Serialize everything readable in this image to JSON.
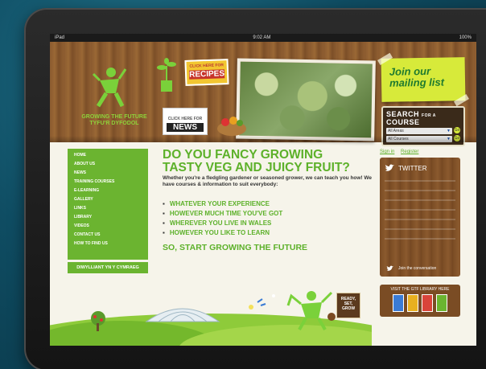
{
  "status_bar": {
    "device": "iPad",
    "time": "9:02 AM",
    "battery": "100%"
  },
  "header": {
    "tagline_line1": "GROWING THE FUTURE",
    "tagline_line2": "TYFU'R DYFODOL",
    "recipes_small": "CLICK HERE FOR",
    "recipes_big": "RECIPES",
    "news_small": "CLICK HERE FOR",
    "news_big": "NEWS",
    "mailing_line1": "Join our",
    "mailing_line2": "mailing list",
    "search_title": "SEARCH",
    "search_for": "FOR A",
    "search_course": "COURSE",
    "area_value": "All Areas",
    "course_value": "All Courses",
    "go_label": "Go"
  },
  "nav": {
    "items": [
      "HOME",
      "ABOUT US",
      "NEWS",
      "TRAINING COURSES",
      "E-LEARNING",
      "GALLERY",
      "LINKS",
      "LIBRARY",
      "VIDEOS",
      "CONTACT US",
      "HOW TO FIND US"
    ],
    "welsh": "DIWYLLIANT YN Y CYMRAEG"
  },
  "main": {
    "heading_line1": "DO YOU FANCY GROWING",
    "heading_line2": "TASTY VEG AND JUICY FRUIT?",
    "intro": "Whether you're a fledgling gardener or seasoned grower, we can teach you how! We have courses & information to suit everybody:",
    "bullets": [
      "WHATEVER YOUR EXPERIENCE",
      "HOWEVER MUCH TIME YOU'VE GOT",
      "WHEREVER YOU LIVE IN WALES",
      "HOWEVER YOU LIKE TO LEARN"
    ],
    "subheading": "SO, START GROWING THE FUTURE",
    "sign_line1": "READY,",
    "sign_line2": "SET,",
    "sign_line3": "GROW"
  },
  "sidebar": {
    "sign_in": "Sign in",
    "register": "Register",
    "twitter_title": "TWITTER",
    "twitter_join": "Join the conversation",
    "library_title": "VISIT THE GTF LIBRARY HERE"
  },
  "colors": {
    "brand_green": "#5db12a",
    "nav_green": "#6bb430",
    "wood": "#8a5a2f",
    "mailing_yellow": "#d7ea3a"
  }
}
